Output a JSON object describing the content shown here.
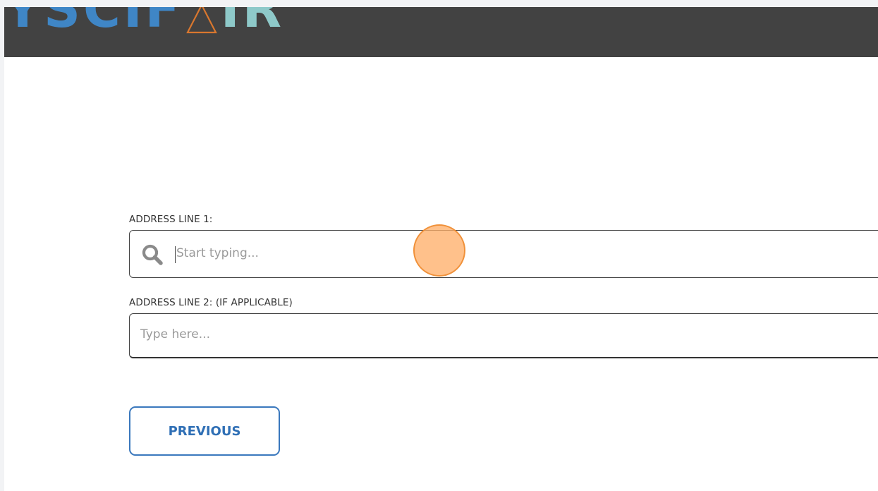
{
  "header": {
    "logo_left": "YSCIF",
    "logo_right": "IR",
    "colors": {
      "bar": "#424242",
      "blue": "#3f86c6",
      "teal": "#8ec9c9",
      "triangle": "#d9772e"
    }
  },
  "form": {
    "address_line_1": {
      "label": "ADDRESS LINE 1:",
      "placeholder": "Start typing...",
      "value": "",
      "icon": "search-icon"
    },
    "address_line_2": {
      "label": "ADDRESS LINE 2: (IF APPLICABLE)",
      "placeholder": "Type here...",
      "value": ""
    }
  },
  "navigation": {
    "previous_label": "PREVIOUS",
    "accent_color": "#2f6fb5"
  }
}
